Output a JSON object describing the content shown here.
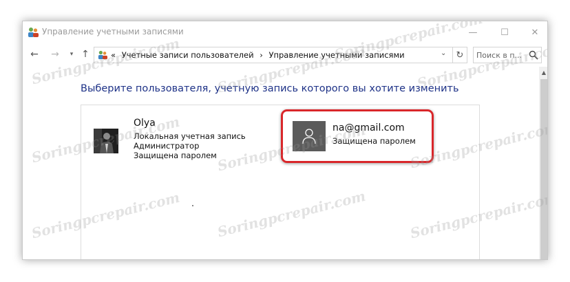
{
  "window": {
    "title": "Управление учетными записями",
    "controls": {
      "minimize": "—",
      "maximize": "☐",
      "close": "✕"
    }
  },
  "nav": {
    "back": "←",
    "forward": "→",
    "recent": "▾",
    "up": "↑",
    "breadcrumb_prefix": "«",
    "breadcrumb": [
      "Учетные записи пользователей",
      "›",
      "Управление учетными записями"
    ],
    "address_chevron": "⌄",
    "refresh": "↻",
    "search_placeholder": "Поиск в п..."
  },
  "main": {
    "heading": "Выберите пользователя, учетную запись которого вы хотите изменить",
    "users": [
      {
        "name": "Olya",
        "lines": [
          "Локальная учетная запись",
          "Администратор",
          "Защищена паролем"
        ]
      },
      {
        "name": "na@gmail.com",
        "lines": [
          "Защищена паролем"
        ]
      }
    ]
  },
  "scrollbar": {
    "up": "▲"
  },
  "watermark": "Soringpcrepair.com",
  "colors": {
    "heading": "#1e3287",
    "highlight": "#d9262a",
    "avatar_bg": "#5b5b5b"
  },
  "icons": [
    "users-icon",
    "arrow-left-icon",
    "arrow-right-icon",
    "chevron-down-icon",
    "arrow-up-icon",
    "refresh-icon",
    "search-icon",
    "user-avatar-icon"
  ]
}
